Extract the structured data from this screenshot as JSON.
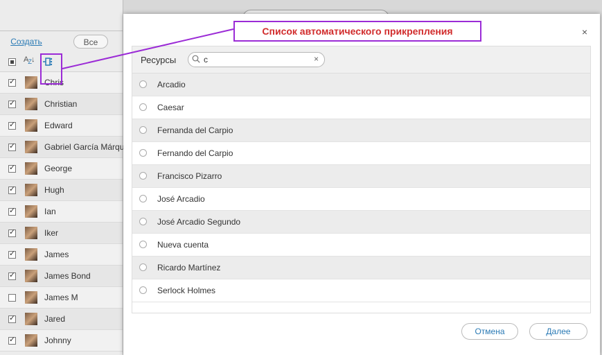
{
  "left_panel": {
    "create_label": "Создать",
    "all_label": "Все",
    "resources": [
      {
        "name": "Chris",
        "checked": true
      },
      {
        "name": "Christian",
        "checked": true
      },
      {
        "name": "Edward",
        "checked": true
      },
      {
        "name": "Gabriel García Márquez",
        "checked": true
      },
      {
        "name": "George",
        "checked": true
      },
      {
        "name": "Hugh",
        "checked": true
      },
      {
        "name": "Ian",
        "checked": true
      },
      {
        "name": "Iker",
        "checked": true
      },
      {
        "name": "James",
        "checked": true
      },
      {
        "name": "James Bond",
        "checked": true
      },
      {
        "name": "James M",
        "checked": false
      },
      {
        "name": "Jared",
        "checked": true
      },
      {
        "name": "Johnny",
        "checked": true
      }
    ]
  },
  "callout": {
    "text": "Список автоматического прикрепления",
    "color": "#9b2bd6",
    "text_color": "#d12c2c"
  },
  "modal": {
    "close_icon": "×",
    "filter_label": "Ресурсы",
    "search_value": "c",
    "clear_icon": "×",
    "options": [
      "Arcadio",
      "Caesar",
      "Fernanda del Carpio",
      "Fernando del Carpio",
      "Francisco Pizarro",
      "José Arcadio",
      "José Arcadio Segundo",
      "Nueva cuenta",
      "Ricardo Martínez",
      "Serlock Holmes"
    ],
    "cancel_label": "Отмена",
    "next_label": "Далее"
  },
  "colors": {
    "accent": "#2a7ab5",
    "annotation": "#9b2bd6"
  }
}
